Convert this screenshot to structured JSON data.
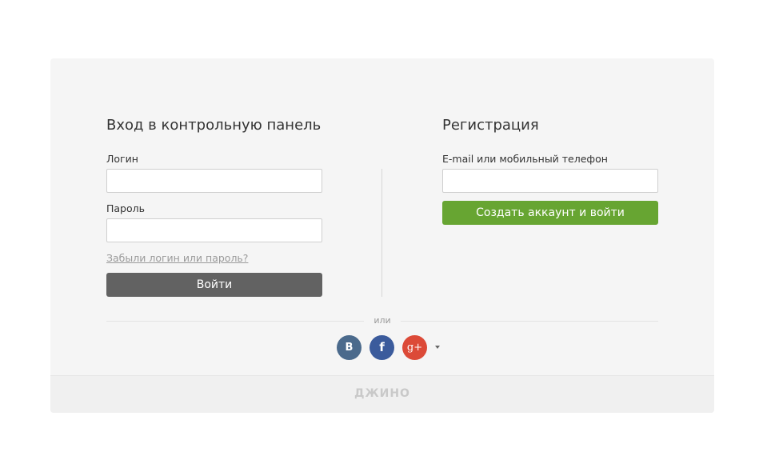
{
  "login": {
    "title": "Вход в контрольную панель",
    "login_label": "Логин",
    "login_value": "",
    "password_label": "Пароль",
    "password_value": "",
    "forgot_link": "Забыли логин или пароль?",
    "submit_label": "Войти"
  },
  "register": {
    "title": "Регистрация",
    "contact_label": "E-mail или мобильный телефон",
    "contact_value": "",
    "submit_label": "Создать аккаунт и войти"
  },
  "divider": {
    "or_text": "или"
  },
  "social": {
    "vk_label": "B",
    "facebook_label": "f",
    "google_label": "g+",
    "more_icon": "caret-down-icon"
  },
  "footer": {
    "logo_text": "ДЖИНО"
  },
  "colors": {
    "login_button": "#626262",
    "register_button": "#67a532",
    "vk": "#4b6a8c",
    "facebook": "#3b5b9c",
    "google": "#dc4a38"
  }
}
